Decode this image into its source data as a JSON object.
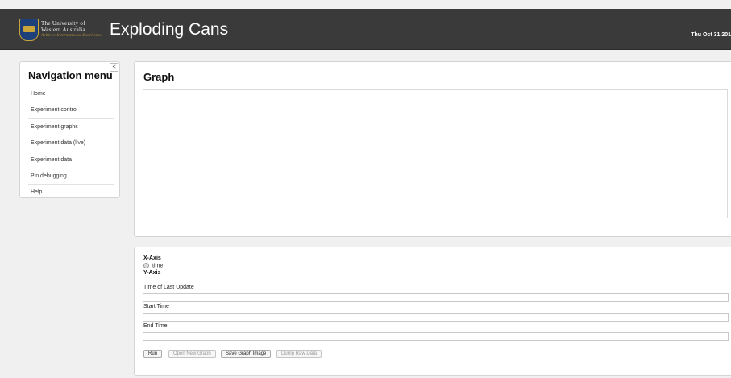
{
  "header": {
    "university_line1": "The University of",
    "university_line2": "Western Australia",
    "motto": "Achieve International Excellence",
    "app_title": "Exploding Cans",
    "date": "Thu Oct 31 201"
  },
  "nav": {
    "title": "Navigation menu",
    "collapse_label": "<",
    "items": [
      {
        "label": "Home"
      },
      {
        "label": "Experiment control"
      },
      {
        "label": "Experiment graphs"
      },
      {
        "label": "Experiment data (live)"
      },
      {
        "label": "Experiment data"
      },
      {
        "label": "Pin debugging"
      },
      {
        "label": "Help"
      }
    ]
  },
  "graph": {
    "title": "Graph"
  },
  "controls": {
    "x_axis_label": "X-Axis",
    "x_axis_option": "time",
    "y_axis_label": "Y-Axis",
    "last_update_label": "Time of Last Update",
    "last_update_value": "",
    "start_time_label": "Start Time",
    "start_time_value": "",
    "end_time_label": "End Time",
    "end_time_value": "",
    "buttons": {
      "run": "Run",
      "open_new_graph": "Open New Graph",
      "save_graph_image": "Save Graph Image",
      "dump_raw_data": "Dump Raw Data"
    }
  },
  "colors": {
    "header_bg": "#3a3a3a",
    "page_bg": "#f0f0f0",
    "panel_bg": "#ffffff"
  }
}
